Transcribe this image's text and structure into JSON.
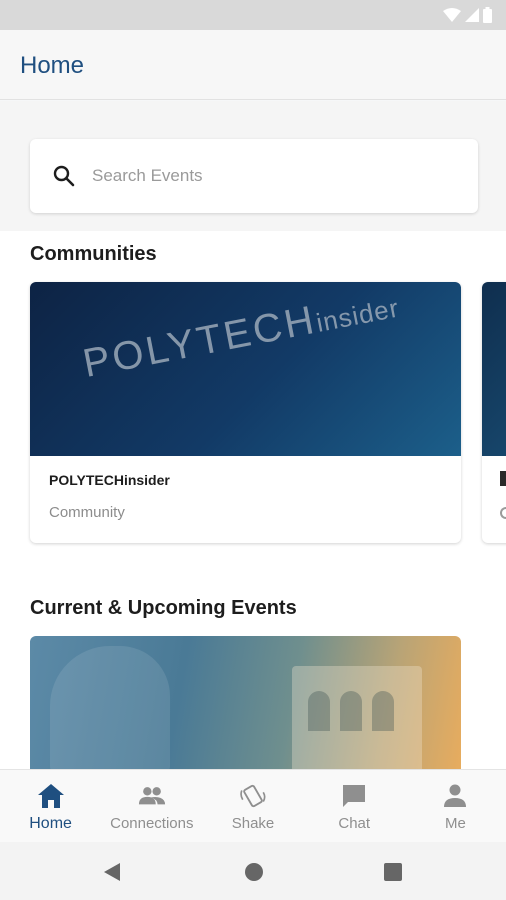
{
  "header": {
    "title": "Home"
  },
  "search": {
    "placeholder": "Search Events"
  },
  "communities": {
    "heading": "Communities",
    "cards": [
      {
        "image_text": "POLYTECH",
        "image_text_small": "insider",
        "title": "POLYTECHinsider",
        "subtitle": "Community"
      }
    ]
  },
  "events": {
    "heading": "Current & Upcoming Events"
  },
  "bottom_nav": {
    "items": [
      {
        "label": "Home",
        "icon": "home-icon",
        "active": true
      },
      {
        "label": "Connections",
        "icon": "people-icon",
        "active": false
      },
      {
        "label": "Shake",
        "icon": "shake-phone-icon",
        "active": false
      },
      {
        "label": "Chat",
        "icon": "chat-bubble-icon",
        "active": false
      },
      {
        "label": "Me",
        "icon": "person-icon",
        "active": false
      }
    ]
  },
  "colors": {
    "accent": "#1f4f80",
    "inactive": "#8f8f8f",
    "card_bg_dark": "#0d2344"
  }
}
